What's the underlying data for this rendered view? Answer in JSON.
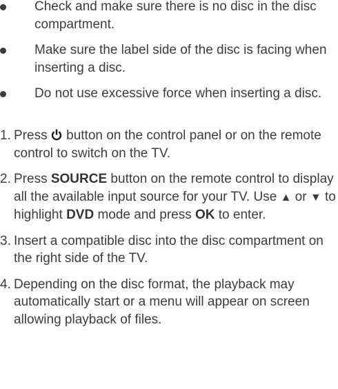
{
  "bullets": [
    "Check and make sure there is no disc in the disc compartment.",
    "Make sure the label side of the disc is facing when inserting a disc.",
    "Do not use excessive force when inserting a disc."
  ],
  "steps": [
    {
      "num": "1.",
      "pre": "Press",
      "icon": "power-icon",
      "post": "button on the control panel or on the remote control to switch on the TV."
    },
    {
      "num": "2.",
      "t1": "Press ",
      "k1": "SOURCE",
      "t2": " button on the remote control to display all the available input source for your TV. Use ",
      "up": "▲",
      "t3": " or ",
      "down": "▼",
      "t4": " to highlight ",
      "k2": "DVD",
      "t5": " mode and press ",
      "k3": "OK",
      "t6": " to enter."
    },
    {
      "num": "3.",
      "text": "Insert a compatible disc into the disc compartment on the right side of the TV."
    },
    {
      "num": "4.",
      "text": "Depending on the disc format, the playback may automatically start or a menu will appear on screen allowing playback of files."
    }
  ]
}
